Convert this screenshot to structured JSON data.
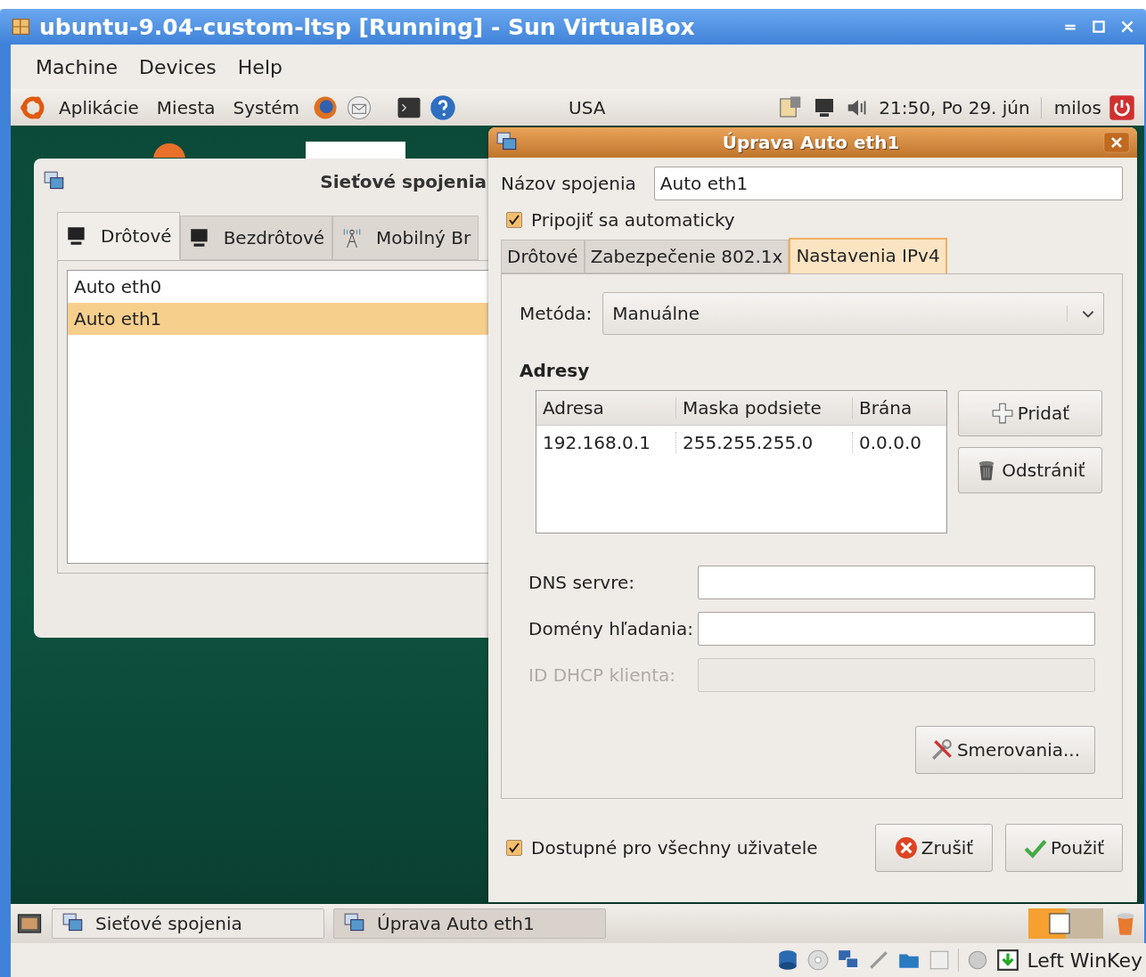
{
  "window": {
    "title": "ubuntu-9.04-custom-ltsp [Running] - Sun VirtualBox"
  },
  "menu_bar": [
    "Machine",
    "Devices",
    "Help"
  ],
  "top_panel": {
    "menus": [
      "Aplikácie",
      "Miesta",
      "Systém"
    ],
    "keyboard_layout": "USA",
    "clock": "21:50, Po 29. jún",
    "user": "milos"
  },
  "connections_window": {
    "title": "Sieťové spojenia",
    "tabs": [
      {
        "label": "Drôtové",
        "selected": true
      },
      {
        "label": "Bezdrôtové",
        "selected": false
      },
      {
        "label": "Mobilný Br",
        "selected": false
      }
    ],
    "connections": [
      {
        "name": "Auto eth0",
        "selected": false
      },
      {
        "name": "Auto eth1",
        "selected": true
      }
    ]
  },
  "edit_dialog": {
    "title": "Úprava Auto eth1",
    "name_label": "Názov spojenia",
    "name_value": "Auto eth1",
    "auto_connect": {
      "label": "Pripojiť sa automaticky",
      "checked": true
    },
    "tabs": [
      {
        "label": "Drôtové",
        "selected": false
      },
      {
        "label": "Zabezpečenie 802.1x",
        "selected": false
      },
      {
        "label": "Nastavenia IPv4",
        "selected": true
      }
    ],
    "method_label": "Metóda:",
    "method_value": "Manuálne",
    "addresses_heading": "Adresy",
    "address_columns": [
      "Adresa",
      "Maska podsiete",
      "Brána"
    ],
    "address_rows": [
      [
        "192.168.0.1",
        "255.255.255.0",
        "0.0.0.0"
      ]
    ],
    "add_button": "Pridať",
    "remove_button": "Odstrániť",
    "fields": [
      {
        "label": "DNS servre:",
        "disabled": false
      },
      {
        "label": "Domény hľadania:",
        "disabled": false
      },
      {
        "label": "ID DHCP klienta:",
        "disabled": true
      }
    ],
    "routes_button": "Smerovania...",
    "all_users": {
      "label": "Dostupné pro všechny uživatele",
      "checked": true
    },
    "cancel_button": "Zrušiť",
    "apply_button": "Použiť"
  },
  "taskbar": [
    {
      "label": "Sieťové spojenia",
      "selected": false
    },
    {
      "label": "Úprava Auto eth1",
      "selected": true
    }
  ],
  "status_bar": {
    "host_key": "Left WinKey"
  }
}
